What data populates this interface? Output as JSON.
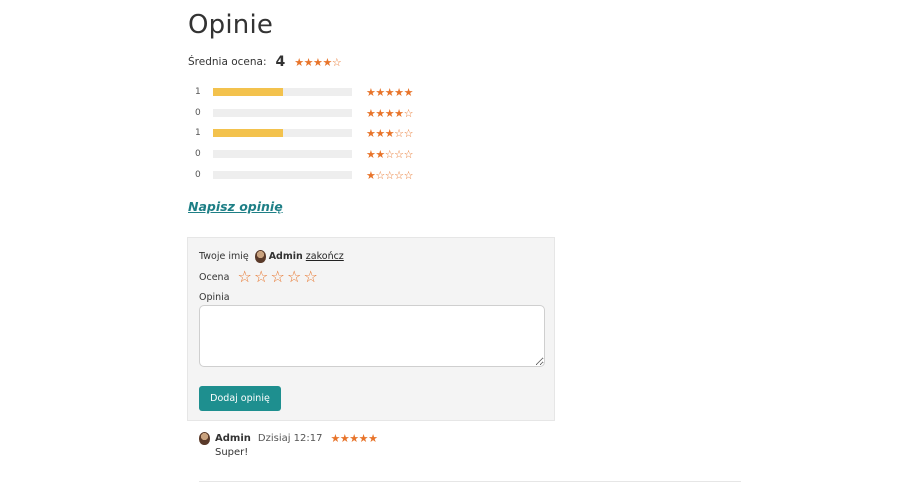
{
  "page": {
    "title": "Opinie"
  },
  "summary": {
    "label": "Średnia ocena:",
    "value": "4",
    "stars": 4,
    "max_stars": 5
  },
  "histogram": [
    {
      "count": "1",
      "fraction": 0.5,
      "stars": 5
    },
    {
      "count": "0",
      "fraction": 0,
      "stars": 4
    },
    {
      "count": "1",
      "fraction": 0.5,
      "stars": 3
    },
    {
      "count": "0",
      "fraction": 0,
      "stars": 2
    },
    {
      "count": "0",
      "fraction": 0,
      "stars": 1
    }
  ],
  "write_link": "Napisz opinię",
  "form": {
    "name_label": "Twoje imię",
    "user_name": "Admin",
    "logout": "zakończ",
    "rating_label": "Ocena",
    "rating_value": 0,
    "opinion_label": "Opinia",
    "opinion_value": "",
    "submit_label": "Dodaj opinię"
  },
  "reviews": [
    {
      "author": "Admin",
      "time": "Dzisiaj 12:17",
      "stars": 5,
      "text": "Super!"
    }
  ],
  "colors": {
    "star": "#e8742a",
    "bar_fill": "#f3c24d",
    "bar_bg": "#eeeeee",
    "link": "#1e7f86",
    "button": "#1e8f8f"
  },
  "icons": {
    "star_full": "star-filled-icon",
    "star_empty": "star-outline-icon",
    "avatar": "user-avatar-icon"
  }
}
